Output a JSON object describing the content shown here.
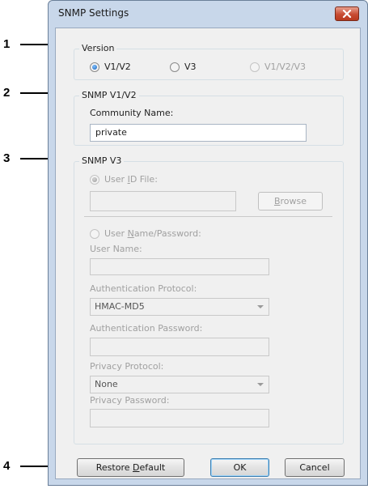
{
  "window": {
    "title": "SNMP Settings"
  },
  "callouts": [
    "1",
    "2",
    "3",
    "4"
  ],
  "version": {
    "legend": "Version",
    "options": [
      {
        "label": "V1/V2",
        "selected": true,
        "enabled": true
      },
      {
        "label": "V3",
        "selected": false,
        "enabled": true
      },
      {
        "label": "V1/V2/V3",
        "selected": false,
        "enabled": false
      }
    ]
  },
  "v1v2": {
    "legend": "SNMP V1/V2",
    "community_label": "Community Name:",
    "community_value": "private"
  },
  "v3": {
    "legend": "SNMP V3",
    "user_id_file": {
      "pre": "User ",
      "key": "I",
      "post": "D File:"
    },
    "user_id_value": "",
    "browse": {
      "pre": "",
      "key": "B",
      "post": "rowse"
    },
    "user_name_password": {
      "pre": "User ",
      "key": "N",
      "post": "ame/Password:"
    },
    "user_name_label": "User Name:",
    "auth_protocol_label": "Authentication Protocol:",
    "auth_protocol_value": "HMAC-MD5",
    "auth_password_label": "Authentication Password:",
    "privacy_protocol_label": "Privacy Protocol:",
    "privacy_protocol_value": "None",
    "privacy_password_label": "Privacy Password:"
  },
  "footer": {
    "restore": {
      "pre": "Restore ",
      "key": "D",
      "post": "efault"
    },
    "ok": "OK",
    "cancel": "Cancel"
  }
}
